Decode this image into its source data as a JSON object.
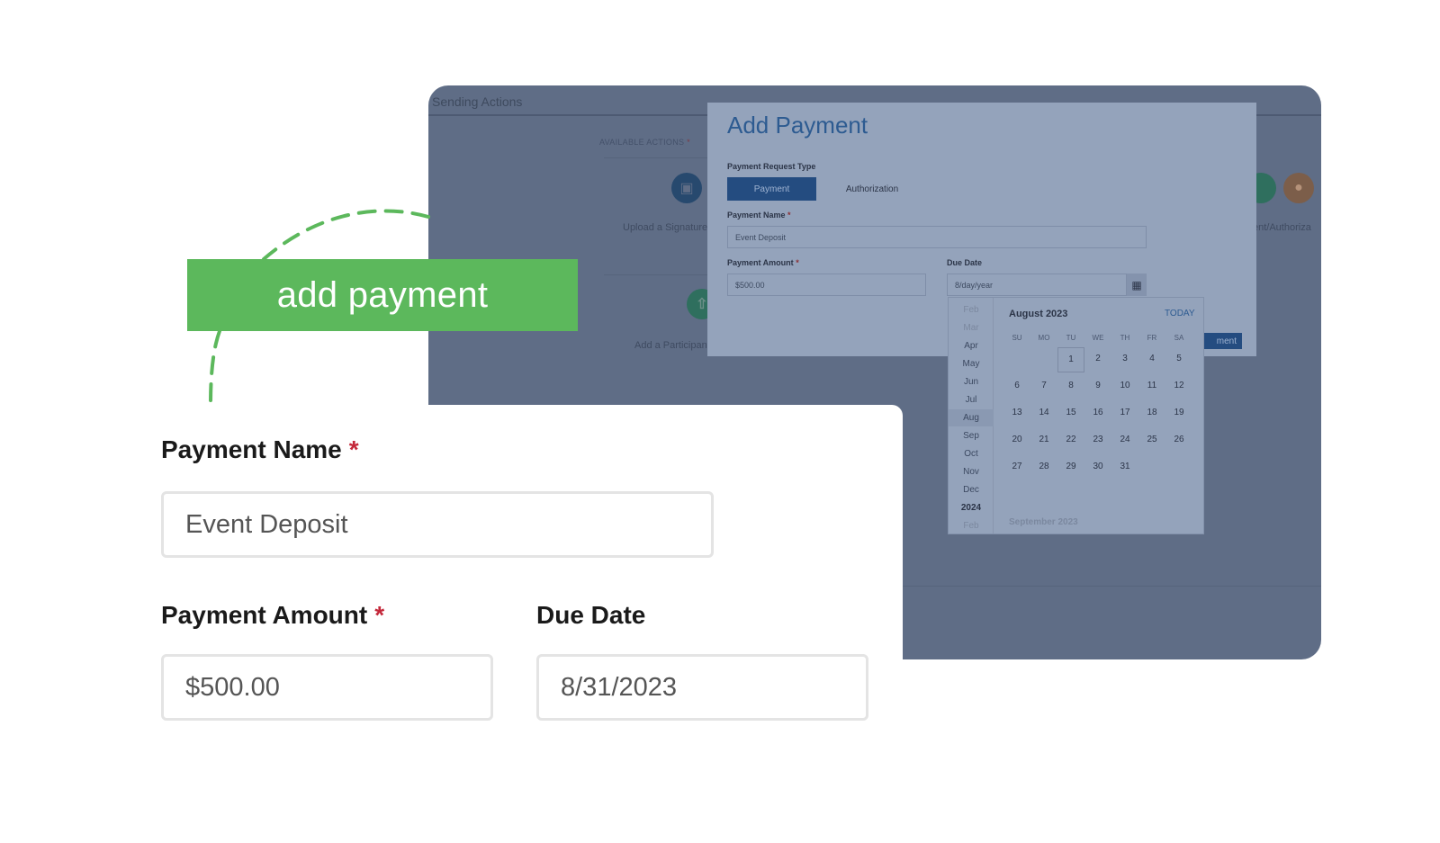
{
  "background_app": {
    "section_title": "Sending Actions",
    "available_actions_label": "AVAILABLE ACTIONS",
    "required_mark": "*",
    "actions": [
      {
        "label": "Upload a Signature",
        "icon": "document-icon"
      },
      {
        "label": "Add a Participant",
        "icon": "upload-icon"
      },
      {
        "label": "ent/Authoriza",
        "icon": "lock-icon"
      }
    ]
  },
  "modal": {
    "title": "Add Payment",
    "request_type_label": "Payment Request Type",
    "request_types": [
      "Payment",
      "Authorization"
    ],
    "selected_request_type": "Payment",
    "payment_name_label": "Payment Name",
    "payment_name_value": "Event Deposit",
    "payment_amount_label": "Payment Amount",
    "payment_amount_value": "$500.00",
    "due_date_label": "Due Date",
    "due_date_placeholder": "8/day/year",
    "submit_label": "ment",
    "required_mark": "*"
  },
  "date_picker": {
    "month_list": [
      "Feb",
      "Mar",
      "Apr",
      "May",
      "Jun",
      "Jul",
      "Aug",
      "Sep",
      "Oct",
      "Nov",
      "Dec",
      "2024",
      "Feb"
    ],
    "selected_month": "Aug",
    "current_month": "August 2023",
    "today_label": "TODAY",
    "weekdays": [
      "SU",
      "MO",
      "TU",
      "WE",
      "TH",
      "FR",
      "SA"
    ],
    "weeks": [
      [
        "",
        "",
        "1",
        "2",
        "3",
        "4",
        "5"
      ],
      [
        "6",
        "7",
        "8",
        "9",
        "10",
        "11",
        "12"
      ],
      [
        "13",
        "14",
        "15",
        "16",
        "17",
        "18",
        "19"
      ],
      [
        "20",
        "21",
        "22",
        "23",
        "24",
        "25",
        "26"
      ],
      [
        "27",
        "28",
        "29",
        "30",
        "31",
        "",
        ""
      ]
    ],
    "highlighted_day": "1",
    "next_month": "September 2023"
  },
  "callout": {
    "text": "add payment",
    "color": "#5cb85c"
  },
  "form": {
    "payment_name_label": "Payment Name",
    "payment_name_value": "Event Deposit",
    "payment_amount_label": "Payment Amount",
    "payment_amount_value": "$500.00",
    "due_date_label": "Due Date",
    "due_date_value": "8/31/2023",
    "required_mark": "*",
    "required_color": "#c4283a"
  }
}
